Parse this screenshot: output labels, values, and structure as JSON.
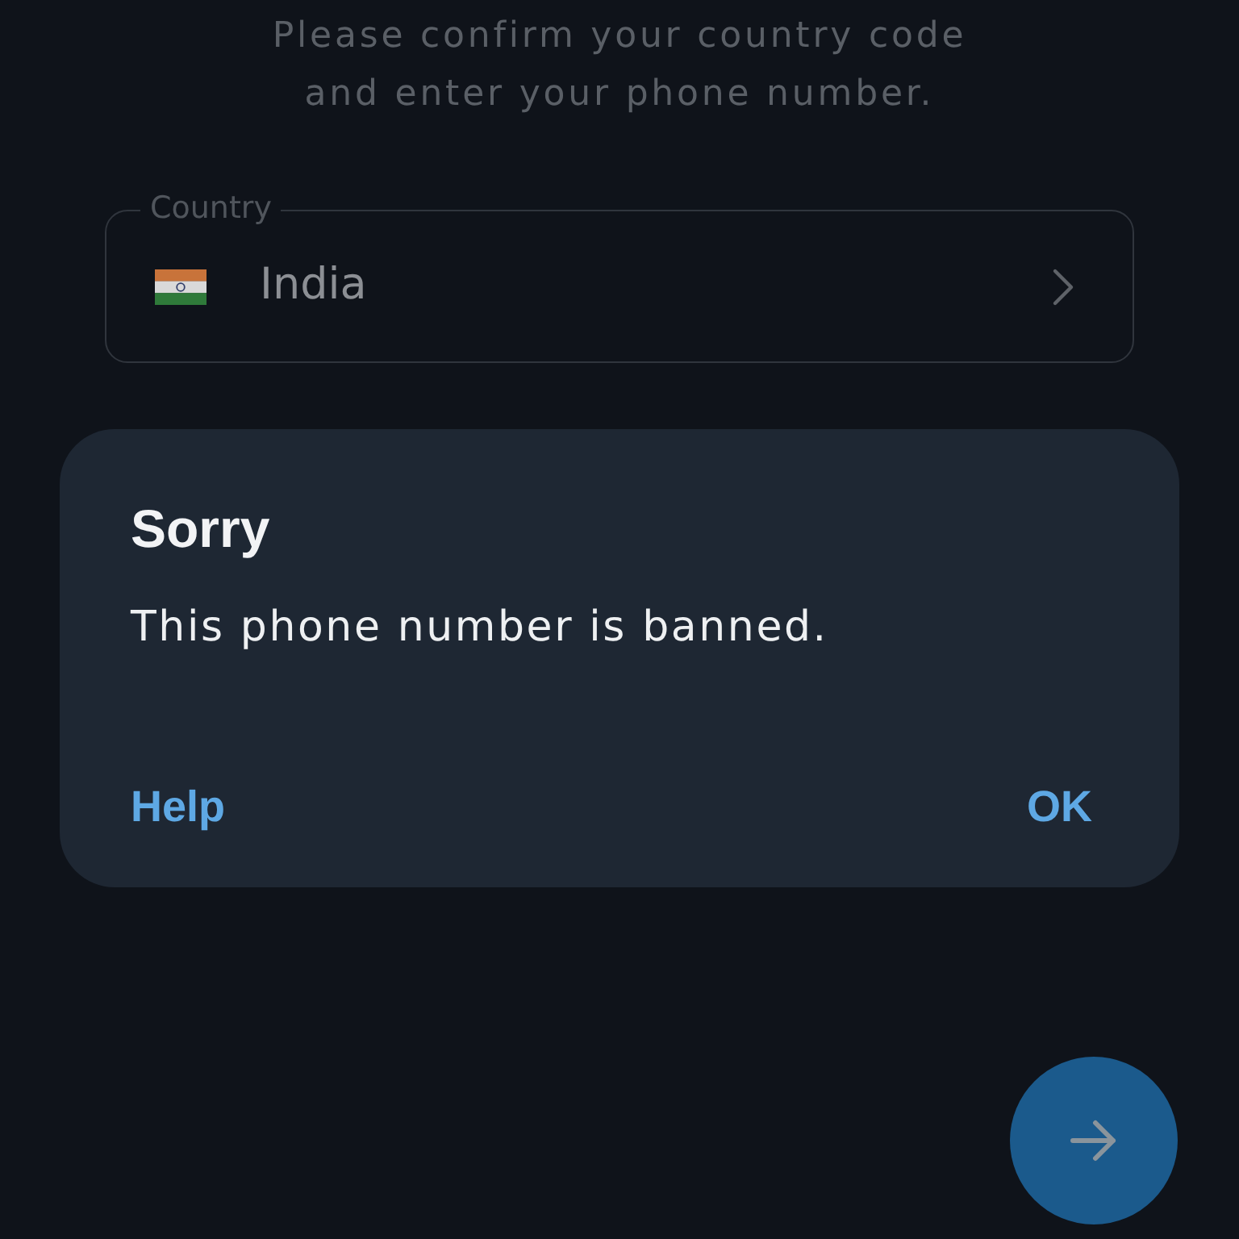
{
  "intro": {
    "text": "Please confirm your country code and enter your phone number."
  },
  "country_field": {
    "label": "Country",
    "value": "India"
  },
  "dialog": {
    "title": "Sorry",
    "message": "This phone number is banned.",
    "buttons": [
      {
        "label": "Help"
      },
      {
        "label": "OK"
      }
    ]
  }
}
